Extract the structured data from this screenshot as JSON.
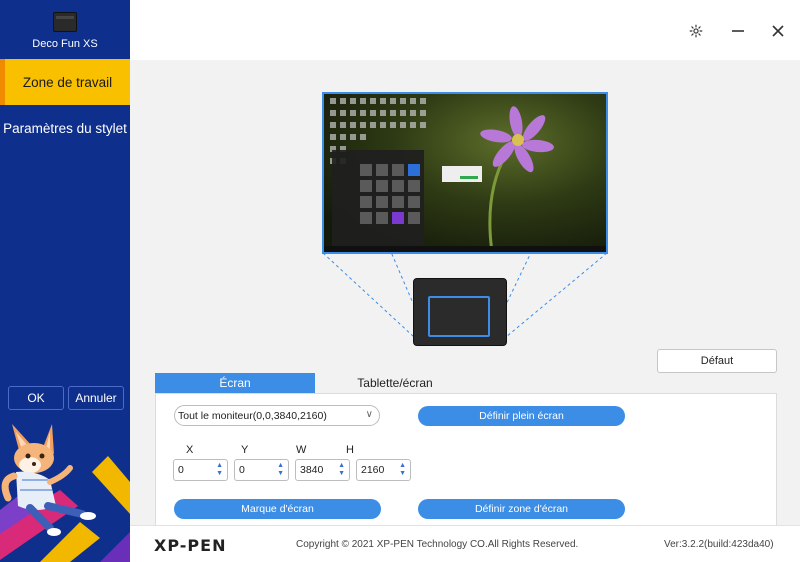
{
  "sidebar": {
    "device_name": "Deco Fun XS",
    "items": [
      {
        "label": "Zone de travail"
      },
      {
        "label": "Paramètres du stylet"
      }
    ],
    "ok_label": "OK",
    "cancel_label": "Annuler"
  },
  "colors": {
    "sidebar_bg": "#0e2f8c",
    "active_item_bg": "#f9c000",
    "accent_blue": "#3b8de6"
  },
  "window": {
    "icons": [
      "gear-icon",
      "minimize-icon",
      "close-icon"
    ]
  },
  "main": {
    "default_label": "Défaut",
    "tabs": [
      {
        "label": "Écran"
      },
      {
        "label": "Tablette/écran"
      }
    ],
    "monitor_select": "Tout le moniteur(0,0,3840,2160)",
    "full_screen_label": "Définir plein écran",
    "fields": [
      {
        "label": "X",
        "value": "0"
      },
      {
        "label": "Y",
        "value": "0"
      },
      {
        "label": "W",
        "value": "3840"
      },
      {
        "label": "H",
        "value": "2160"
      }
    ],
    "mark_label": "Marque d'écran",
    "define_label": "Définir zone d'écran"
  },
  "footer": {
    "logo": "XP-PEN",
    "copyright": "Copyright © 2021 XP-PEN Technology CO.All Rights Reserved.",
    "version": "Ver:3.2.2(build:423da40)"
  }
}
